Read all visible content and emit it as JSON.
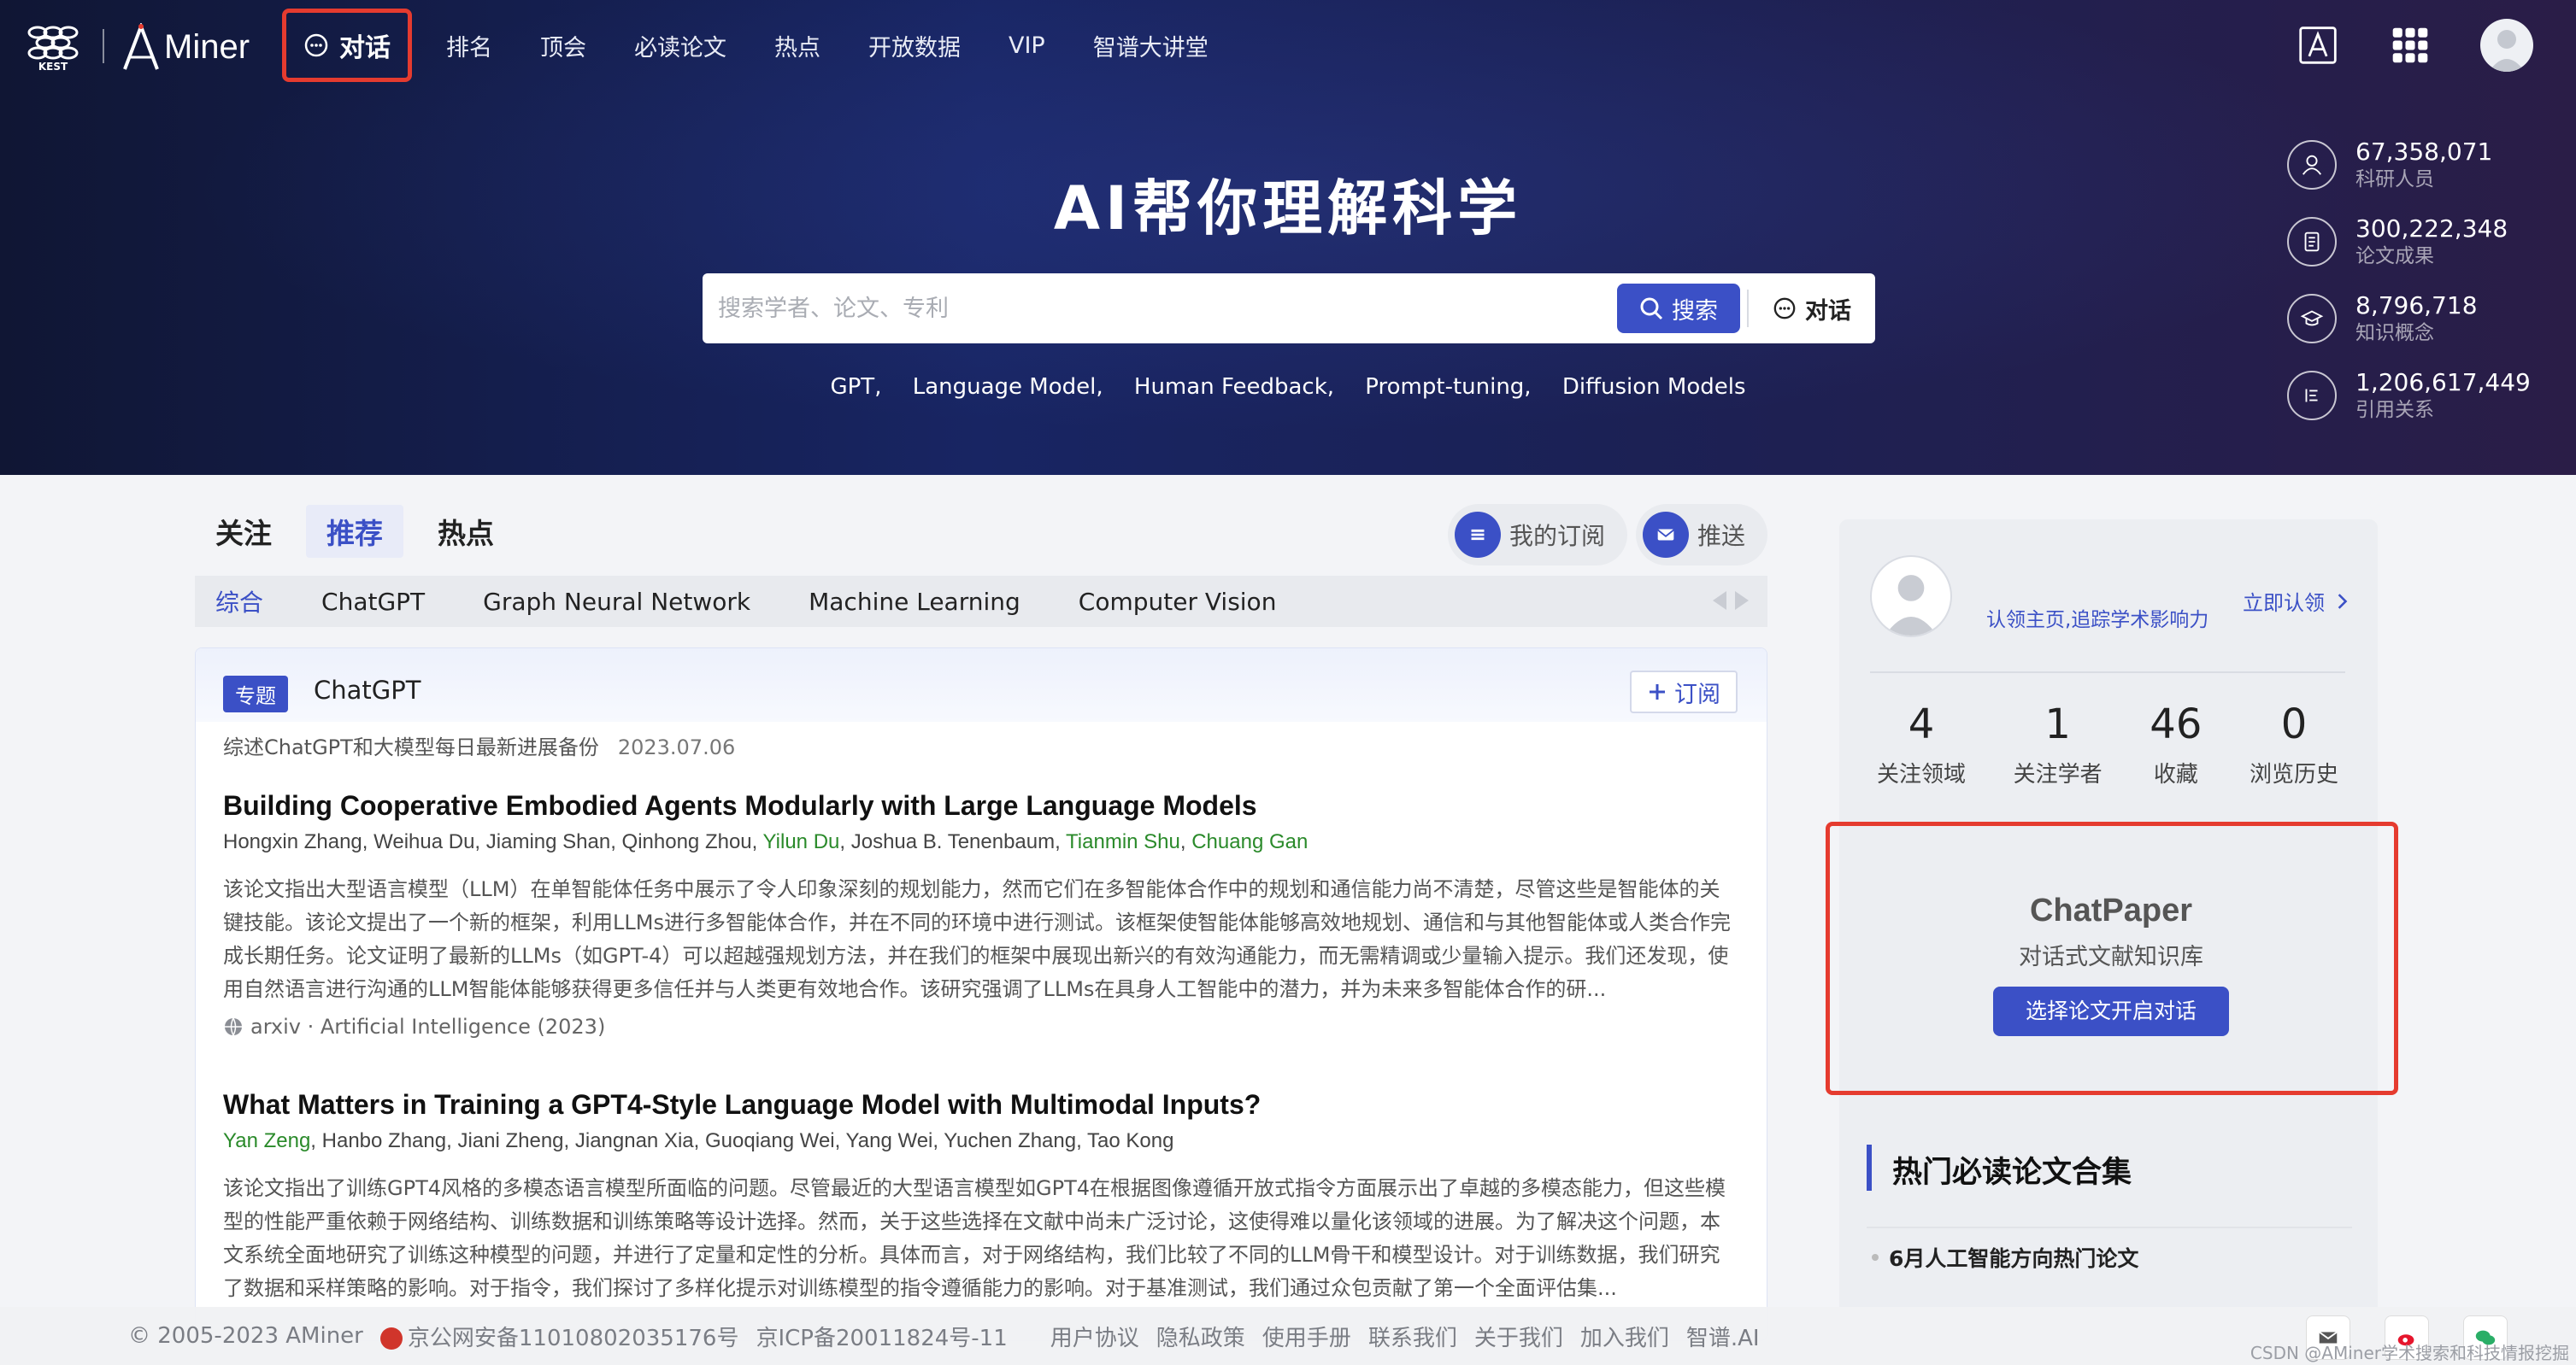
{
  "nav": {
    "brand_text": "Miner",
    "chat_label": "对话",
    "items": [
      "排名",
      "顶会",
      "必读论文",
      "热点",
      "开放数据",
      "VIP",
      "智谱大讲堂"
    ]
  },
  "hero": {
    "title": "AI帮你理解科学",
    "search_placeholder": "搜索学者、论文、专利",
    "search_button": "搜索",
    "chat_button": "对话",
    "hot_keys": [
      "GPT,",
      "Language Model,",
      "Human Feedback,",
      "Prompt-tuning,",
      "Diffusion Models"
    ]
  },
  "stats": [
    {
      "icon": "user-icon",
      "value": "67,358,071",
      "label": "科研人员"
    },
    {
      "icon": "document-icon",
      "value": "300,222,348",
      "label": "论文成果"
    },
    {
      "icon": "graduation-cap-icon",
      "value": "8,796,718",
      "label": "知识概念"
    },
    {
      "icon": "citation-list-icon",
      "value": "1,206,617,449",
      "label": "引用关系"
    }
  ],
  "tabs": [
    {
      "label": "关注",
      "active": false
    },
    {
      "label": "推荐",
      "active": true
    },
    {
      "label": "热点",
      "active": false
    }
  ],
  "sub_buttons": {
    "subscription": "我的订阅",
    "push": "推送"
  },
  "categories": [
    {
      "label": "综合",
      "active": true
    },
    {
      "label": "ChatGPT",
      "active": false
    },
    {
      "label": "Graph Neural Network",
      "active": false
    },
    {
      "label": "Machine Learning",
      "active": false
    },
    {
      "label": "Computer Vision",
      "active": false
    }
  ],
  "topic": {
    "badge": "专题",
    "name": "ChatGPT",
    "follow": "订阅",
    "desc": "综述ChatGPT和大模型每日最新进展备份",
    "date": "2023.07.06"
  },
  "papers": [
    {
      "title": "Building Cooperative Embodied Agents Modularly with Large Language Models",
      "authors": [
        {
          "name": "Hongxin Zhang",
          "hl": false
        },
        {
          "name": "Weihua Du",
          "hl": false
        },
        {
          "name": "Jiaming Shan",
          "hl": false
        },
        {
          "name": "Qinhong Zhou",
          "hl": false
        },
        {
          "name": "Yilun Du",
          "hl": true
        },
        {
          "name": "Joshua B. Tenenbaum",
          "hl": false
        },
        {
          "name": "Tianmin Shu",
          "hl": true
        },
        {
          "name": "Chuang Gan",
          "hl": true
        }
      ],
      "abstract": "该论文指出大型语言模型（LLM）在单智能体任务中展示了令人印象深刻的规划能力，然而它们在多智能体合作中的规划和通信能力尚不清楚，尽管这些是智能体的关键技能。该论文提出了一个新的框架，利用LLMs进行多智能体合作，并在不同的环境中进行测试。该框架使智能体能够高效地规划、通信和与其他智能体或人类合作完成长期任务。论文证明了最新的LLMs（如GPT-4）可以超越强规划方法，并在我们的框架中展现出新兴的有效沟通能力，而无需精调或少量输入提示。我们还发现，使用自然语言进行沟通的LLM智能体能够获得更多信任并与人类更有效地合作。该研究强调了LLMs在具身人工智能中的潜力，并为未来多智能体合作的研...",
      "source": "arxiv · Artificial Intelligence (2023)"
    },
    {
      "title": "What Matters in Training a GPT4-Style Language Model with Multimodal Inputs?",
      "authors": [
        {
          "name": "Yan Zeng",
          "hl": true
        },
        {
          "name": "Hanbo Zhang",
          "hl": false
        },
        {
          "name": "Jiani Zheng",
          "hl": false
        },
        {
          "name": "Jiangnan Xia",
          "hl": false
        },
        {
          "name": "Guoqiang Wei",
          "hl": false
        },
        {
          "name": "Yang Wei",
          "hl": false
        },
        {
          "name": "Yuchen Zhang",
          "hl": false
        },
        {
          "name": "Tao Kong",
          "hl": false
        }
      ],
      "abstract": "该论文指出了训练GPT4风格的多模态语言模型所面临的问题。尽管最近的大型语言模型如GPT4在根据图像遵循开放式指令方面展示出了卓越的多模态能力，但这些模型的性能严重依赖于网络结构、训练数据和训练策略等设计选择。然而，关于这些选择在文献中尚未广泛讨论，这使得难以量化该领域的进展。为了解决这个问题，本文系统全面地研究了训练这种模型的问题，并进行了定量和定性的分析。具体而言，对于网络结构，我们比较了不同的LLM骨干和模型设计。对于训练数据，我们研究了数据和采样策略的影响。对于指令，我们探讨了多样化提示对训练模型的指令遵循能力的影响。对于基准测试，我们通过众包贡献了第一个全面评估集...",
      "source": ""
    }
  ],
  "profile": {
    "claim_text": "认领主页,追踪学术影响力",
    "claim_button": "立即认领",
    "kpis": [
      {
        "value": "4",
        "label": "关注领域"
      },
      {
        "value": "1",
        "label": "关注学者"
      },
      {
        "value": "46",
        "label": "收藏"
      },
      {
        "value": "0",
        "label": "浏览历史"
      }
    ]
  },
  "chatpaper": {
    "title": "ChatPaper",
    "subtitle": "对话式文献知识库",
    "button": "选择论文开启对话"
  },
  "must_read": {
    "title": "热门必读论文合集",
    "items": [
      "6月人工智能方向热门论文"
    ]
  },
  "footer": {
    "copyright": "© 2005-2023 AMiner",
    "police": "京公网安备11010802035176号",
    "icp": "京ICP备20011824号-11",
    "links": [
      "用户协议",
      "隐私政策",
      "使用手册",
      "联系我们",
      "关于我们",
      "加入我们",
      "智谱.AI"
    ],
    "watermark": "CSDN @AMiner学术搜索和科技情报挖掘"
  },
  "colors": {
    "accent": "#3b50c6",
    "highlight_red": "#e53b2f",
    "author_green": "#2a8a2a"
  }
}
